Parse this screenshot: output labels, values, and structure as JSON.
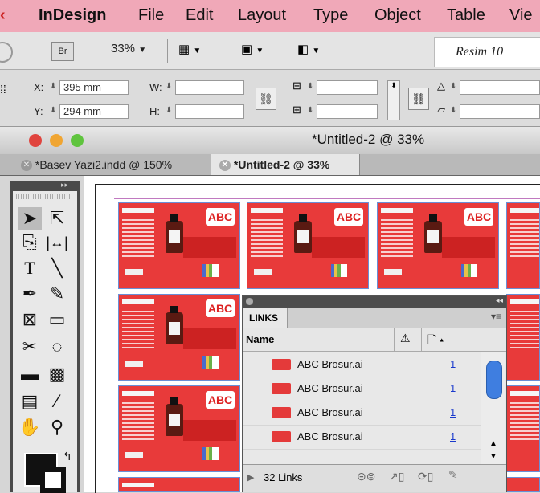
{
  "menubar": {
    "app_name": "InDesign",
    "items": [
      "File",
      "Edit",
      "Layout",
      "Type",
      "Object",
      "Table",
      "Vie"
    ]
  },
  "controlbar": {
    "bridge_label": "Br",
    "zoom": "33%",
    "workspace_label": "Resim 10"
  },
  "transform": {
    "x_label": "X:",
    "x_value": "395 mm",
    "y_label": "Y:",
    "y_value": "294 mm",
    "w_label": "W:",
    "h_label": "H:"
  },
  "window": {
    "title": "*Untitled-2 @ 33%",
    "tabs": [
      "*Basev Yazi2.indd @ 150%",
      "*Untitled-2 @ 33%"
    ]
  },
  "page_logo_text": "ABC",
  "links_panel": {
    "tab_label": "LINKS",
    "column_name": "Name",
    "rows": [
      {
        "name": "ABC Brosur.ai",
        "page": "1"
      },
      {
        "name": "ABC Brosur.ai",
        "page": "1"
      },
      {
        "name": "ABC Brosur.ai",
        "page": "1"
      },
      {
        "name": "ABC Brosur.ai",
        "page": "1"
      }
    ],
    "count": "32 Links"
  },
  "colors": {
    "menubar": "#f0a8b8",
    "page_red": "#e83a3a",
    "page_border": "#6a8ed6",
    "link_blue": "#1a3acc"
  }
}
